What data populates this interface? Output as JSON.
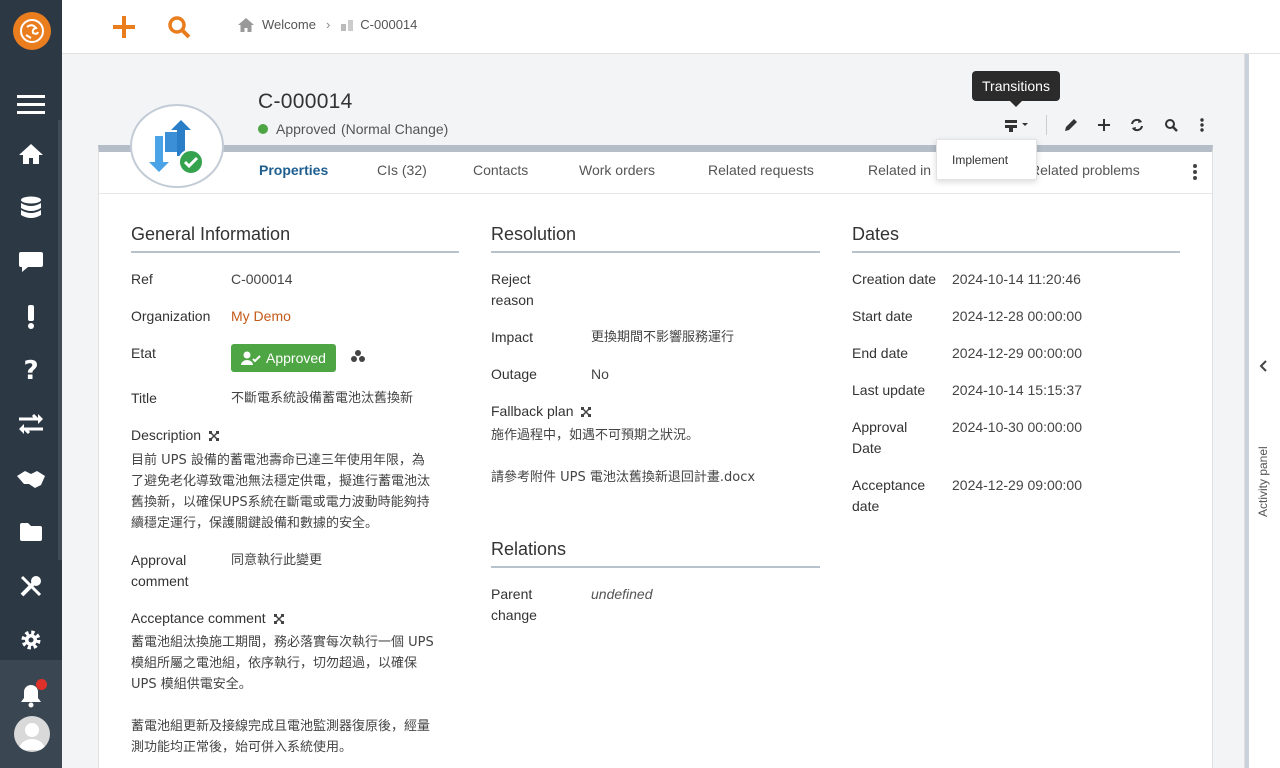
{
  "breadcrumb": {
    "home": "Welcome",
    "current": "C-000014"
  },
  "header": {
    "ref": "C-000014",
    "status": "Approved",
    "status_sub": "(Normal Change)",
    "status_color": "#4ea544"
  },
  "tooltip": "Transitions",
  "transitions_menu": {
    "items": [
      "Implement"
    ]
  },
  "tabs": [
    {
      "label": "Properties",
      "active": true
    },
    {
      "label": "CIs (32)"
    },
    {
      "label": "Contacts"
    },
    {
      "label": "Work orders"
    },
    {
      "label": "Related requests"
    },
    {
      "label": "Related in"
    },
    {
      "label": "Related problems"
    }
  ],
  "general": {
    "heading": "General Information",
    "ref_label": "Ref",
    "ref_value": "C-000014",
    "org_label": "Organization",
    "org_value": "My Demo",
    "etat_label": "Etat",
    "etat_value": "Approved",
    "title_label": "Title",
    "title_value": "不斷電系統設備蓄電池汰舊換新",
    "desc_label": "Description",
    "desc_value": [
      "目前 UPS 設備的蓄電池壽命已達三年使用年限，為",
      "了避免老化導致電池無法穩定供電，擬進行蓄電池汰",
      "舊換新，以確保UPS系統在斷電或電力波動時能夠持",
      "續穩定運行，保護關鍵設備和數據的安全。"
    ],
    "approval_comment_label": [
      "Approval",
      "comment"
    ],
    "approval_comment_value": "同意執行此變更",
    "acceptance_comment_label": "Acceptance comment",
    "acceptance_comment_value": [
      "蓄電池組汰換施工期間，務必落實每次執行一個 UPS",
      "模組所屬之電池組，依序執行，切勿超過，以確保",
      "UPS 模組供電安全。",
      "",
      "蓄電池組更新及接線完成且電池監測器復原後，經量",
      "測功能均正常後，始可併入系統使用。"
    ]
  },
  "resolution": {
    "heading": "Resolution",
    "reject_label": [
      "Reject",
      "reason"
    ],
    "impact_label": "Impact",
    "impact_value": "更換期間不影響服務運行",
    "outage_label": "Outage",
    "outage_value": "No",
    "fallback_label": "Fallback plan",
    "fallback_value": [
      "施作過程中，如遇不可預期之狀況。",
      "",
      "請參考附件 UPS 電池汰舊換新退回計畫.docx"
    ]
  },
  "relations": {
    "heading": "Relations",
    "parent_label": [
      "Parent",
      "change"
    ],
    "parent_value": "undefined"
  },
  "dates": {
    "heading": "Dates",
    "creation_label": "Creation date",
    "creation_value": "2024-10-14 11:20:46",
    "start_label": "Start date",
    "start_value": "2024-12-28 00:00:00",
    "end_label": "End date",
    "end_value": "2024-12-29 00:00:00",
    "update_label": "Last update",
    "update_value": "2024-10-14 15:15:37",
    "approval_label": [
      "Approval",
      "Date"
    ],
    "approval_value": "2024-10-30 00:00:00",
    "acceptance_label": [
      "Acceptance",
      "date"
    ],
    "acceptance_value": "2024-12-29 09:00:00"
  },
  "activity_panel": "Activity panel",
  "colors": {
    "nav_bg": "#2c3945",
    "brand": "#ea7d1e",
    "link": "#c45a1a",
    "tab_active": "#1e5e8f"
  }
}
